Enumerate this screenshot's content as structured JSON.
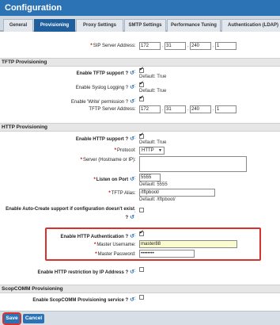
{
  "window": {
    "title": "Configuration"
  },
  "tabs": [
    "General",
    "Provisioning",
    "Proxy Settings",
    "SMTP Settings",
    "Performance Tuning",
    "Authentication (LDAP)"
  ],
  "active_tab": "Provisioning",
  "sip": {
    "label": "SIP Server Address",
    "ip": [
      "172",
      "31",
      "240",
      "1"
    ]
  },
  "tftp": {
    "section": "TFTP Provisioning",
    "enable_label": "Enable TFTP support ?",
    "enable_checked": true,
    "enable_default": "Default: True",
    "syslog_label": "Enable Syslog Logging ?",
    "syslog_checked": true,
    "syslog_default": "Default: True",
    "write_label": "Enable 'Write' permission ?",
    "write_checked": true,
    "server_label": "TFTP Server Address",
    "ip": [
      "172",
      "31",
      "240",
      "1"
    ]
  },
  "http": {
    "section": "HTTP Provisioning",
    "enable_label": "Enable HTTP support ?",
    "enable_checked": true,
    "enable_default": "Default: True",
    "protocol_label": "Protocol",
    "protocol_value": "HTTP",
    "server_label": "Server (Hostname or IP)",
    "server_value": "",
    "port_label": "Listen on Port",
    "port_value": "5555",
    "port_default": "Default: 5555",
    "alias_label": "TFTP Alias",
    "alias_value": "/tftpboot/",
    "alias_default": "Default: /tftpboot/",
    "autocreate_label_1": "Enable Auto-Create support if configuration doesn't exist",
    "autocreate_label_2": "?",
    "autocreate_checked": false,
    "auth_label": "Enable HTTP Authentication ?",
    "auth_checked": true,
    "user_label": "Master Username",
    "user_value": "master88",
    "pass_label": "Master Password",
    "pass_value": "••••••••",
    "restrict_label": "Enable HTTP restriction by IP Address ?",
    "restrict_checked": false
  },
  "scopcomm": {
    "section": "ScopCOMM Provisioning",
    "enable_label": "Enable ScopCOMM Provisioning service ?",
    "enable_checked": false
  },
  "footer": {
    "save": "Save",
    "cancel": "Cancel"
  },
  "colors": {
    "header": "#2c73b5",
    "accent": "#1f5f9e",
    "highlight": "#d9312c"
  }
}
